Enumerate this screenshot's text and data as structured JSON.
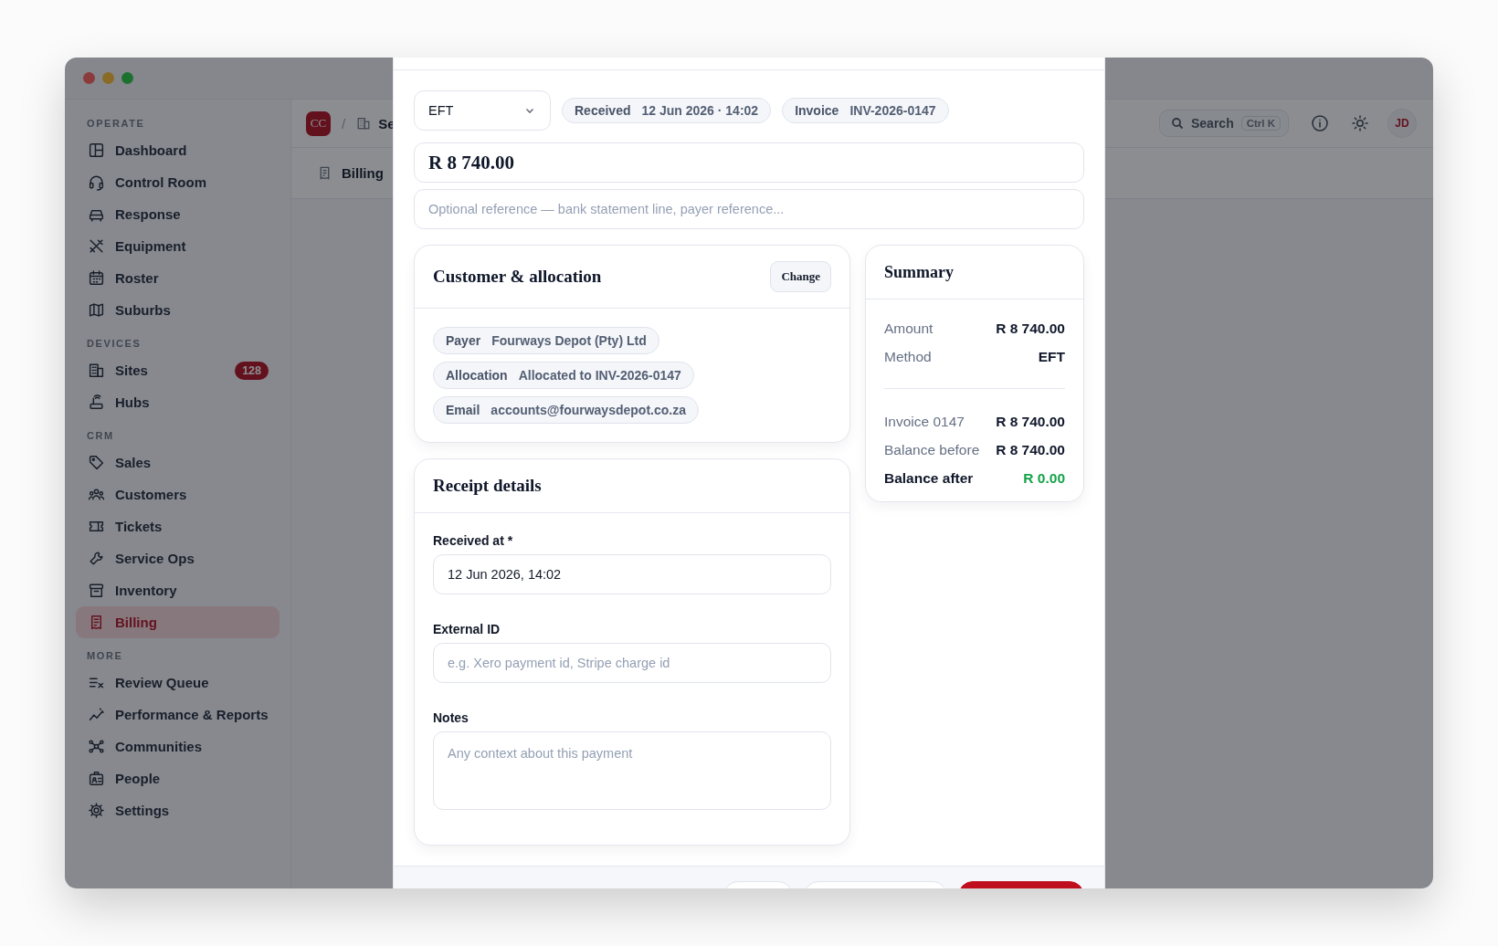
{
  "sidebar": {
    "sections": [
      {
        "label": "OPERATE",
        "items": [
          {
            "label": "Dashboard",
            "selected": false
          },
          {
            "label": "Control Room",
            "selected": false
          },
          {
            "label": "Response",
            "selected": false
          },
          {
            "label": "Equipment",
            "selected": false
          },
          {
            "label": "Roster",
            "selected": false
          },
          {
            "label": "Suburbs",
            "selected": false
          }
        ]
      },
      {
        "label": "DEVICES",
        "items": [
          {
            "label": "Sites",
            "selected": false,
            "badge": "128"
          },
          {
            "label": "Hubs",
            "selected": false
          }
        ]
      },
      {
        "label": "CRM",
        "items": [
          {
            "label": "Sales",
            "selected": false
          },
          {
            "label": "Customers",
            "selected": false
          },
          {
            "label": "Tickets",
            "selected": false
          },
          {
            "label": "Service Ops",
            "selected": false
          },
          {
            "label": "Inventory",
            "selected": false
          },
          {
            "label": "Billing",
            "selected": true
          }
        ]
      },
      {
        "label": "MORE",
        "items": [
          {
            "label": "Review Queue",
            "selected": false
          },
          {
            "label": "Performance & Reports",
            "selected": false
          },
          {
            "label": "Communities",
            "selected": false
          },
          {
            "label": "People",
            "selected": false
          },
          {
            "label": "Settings",
            "selected": false
          }
        ]
      }
    ]
  },
  "header": {
    "logo": "CC",
    "separator": "/",
    "crumb": "Se",
    "search": {
      "label": "Search",
      "shortcut": "Ctrl K"
    },
    "avatar": "JD"
  },
  "page_tab": {
    "label": "Billing"
  },
  "modal": {
    "method": {
      "value": "EFT"
    },
    "pills": [
      {
        "label": "Received",
        "value": "12 Jun 2026 · 14:02"
      },
      {
        "label": "Invoice",
        "value": "INV-2026-0147"
      }
    ],
    "amount": {
      "value": "R 8 740.00"
    },
    "reference": {
      "placeholder": "Optional reference — bank statement line, payer reference..."
    },
    "customer_card": {
      "title": "Customer & allocation",
      "button": "Change",
      "pills": [
        {
          "label": "Payer",
          "value": "Fourways Depot (Pty) Ltd"
        },
        {
          "label": "Allocation",
          "value": "Allocated to INV-2026-0147"
        },
        {
          "label": "Email",
          "value": "accounts@fourwaysdepot.co.za"
        }
      ]
    },
    "receipt_card": {
      "title": "Receipt details",
      "fields": [
        {
          "kind": "input",
          "label": "Received at *",
          "value": "12 Jun 2026, 14:02"
        },
        {
          "kind": "input",
          "label": "External ID",
          "placeholder": "e.g. Xero payment id, Stripe charge id"
        },
        {
          "kind": "textarea",
          "label": "Notes",
          "placeholder": "Any context about this payment"
        }
      ]
    },
    "summary": {
      "title": "Summary",
      "groups": [
        [
          {
            "label": "Amount",
            "value": "R 8 740.00",
            "kind": "normal"
          },
          {
            "label": "Method",
            "value": "EFT",
            "kind": "normal"
          }
        ],
        [
          {
            "label": "Invoice 0147",
            "value": "R 8 740.00",
            "kind": "normal"
          },
          {
            "label": "Balance before",
            "value": "R 8 740.00",
            "kind": "normal"
          },
          {
            "label": "Balance after",
            "value": "R 0.00",
            "kind": "total"
          }
        ]
      ]
    },
    "footer_buttons": [
      {
        "kind": "secondary"
      },
      {
        "kind": "secondary"
      },
      {
        "kind": "primary"
      }
    ]
  }
}
